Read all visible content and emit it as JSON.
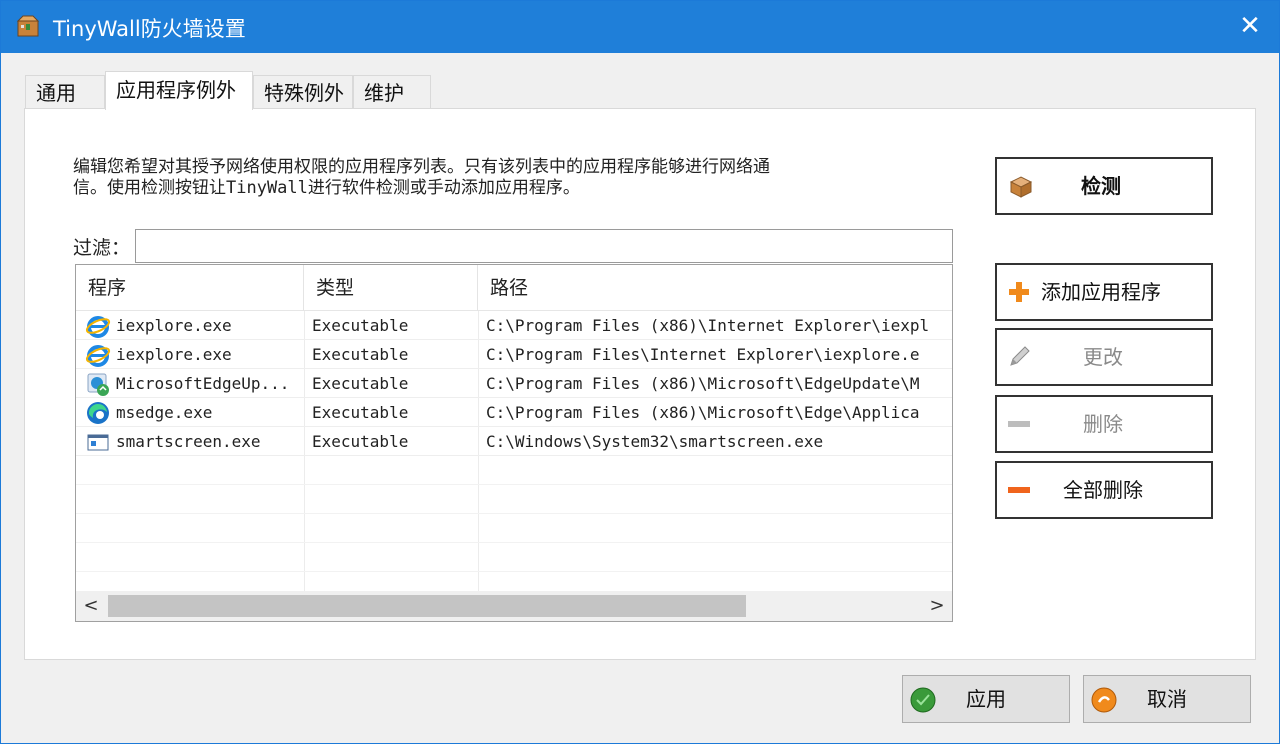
{
  "window": {
    "title": "TinyWall防火墙设置",
    "close_glyph": "✕",
    "icon": "tinywall-box-icon"
  },
  "tabs": [
    {
      "label": "通用",
      "active": false
    },
    {
      "label": "应用程序例外",
      "active": true
    },
    {
      "label": "特殊例外",
      "active": false
    },
    {
      "label": "维护",
      "active": false
    }
  ],
  "description": {
    "line1": "编辑您希望对其授予网络使用权限的应用程序列表。只有该列表中的应用程序能够进行网络通",
    "line2": "信。使用检测按钮让TinyWall进行软件检测或手动添加应用程序。"
  },
  "filter": {
    "label": "过滤：",
    "value": ""
  },
  "list": {
    "columns": [
      "程序",
      "类型",
      "路径"
    ],
    "rows": [
      {
        "program": "iexplore.exe",
        "type": "Executable",
        "path": "C:\\Program Files (x86)\\Internet Explorer\\iexpl",
        "icon": "internet-explorer-icon"
      },
      {
        "program": "iexplore.exe",
        "type": "Executable",
        "path": "C:\\Program Files\\Internet Explorer\\iexplore.e",
        "icon": "internet-explorer-icon"
      },
      {
        "program": "MicrosoftEdgeUp...",
        "type": "Executable",
        "path": "C:\\Program Files (x86)\\Microsoft\\EdgeUpdate\\M",
        "icon": "edge-update-icon"
      },
      {
        "program": "msedge.exe",
        "type": "Executable",
        "path": "C:\\Program Files (x86)\\Microsoft\\Edge\\Applica",
        "icon": "edge-icon"
      },
      {
        "program": "smartscreen.exe",
        "type": "Executable",
        "path": "C:\\Windows\\System32\\smartscreen.exe",
        "icon": "smartscreen-icon"
      }
    ],
    "scroll_left": "<",
    "scroll_right": ">"
  },
  "side_buttons": {
    "detect": "检测",
    "add": "添加应用程序",
    "modify": "更改",
    "remove": "删除",
    "remove_all": "全部删除"
  },
  "bottom_buttons": {
    "apply": "应用",
    "cancel": "取消"
  },
  "colors": {
    "titlebar": "#1f7fd9",
    "add_icon": "#f08a1c",
    "remove_all_icon": "#f0641c"
  }
}
